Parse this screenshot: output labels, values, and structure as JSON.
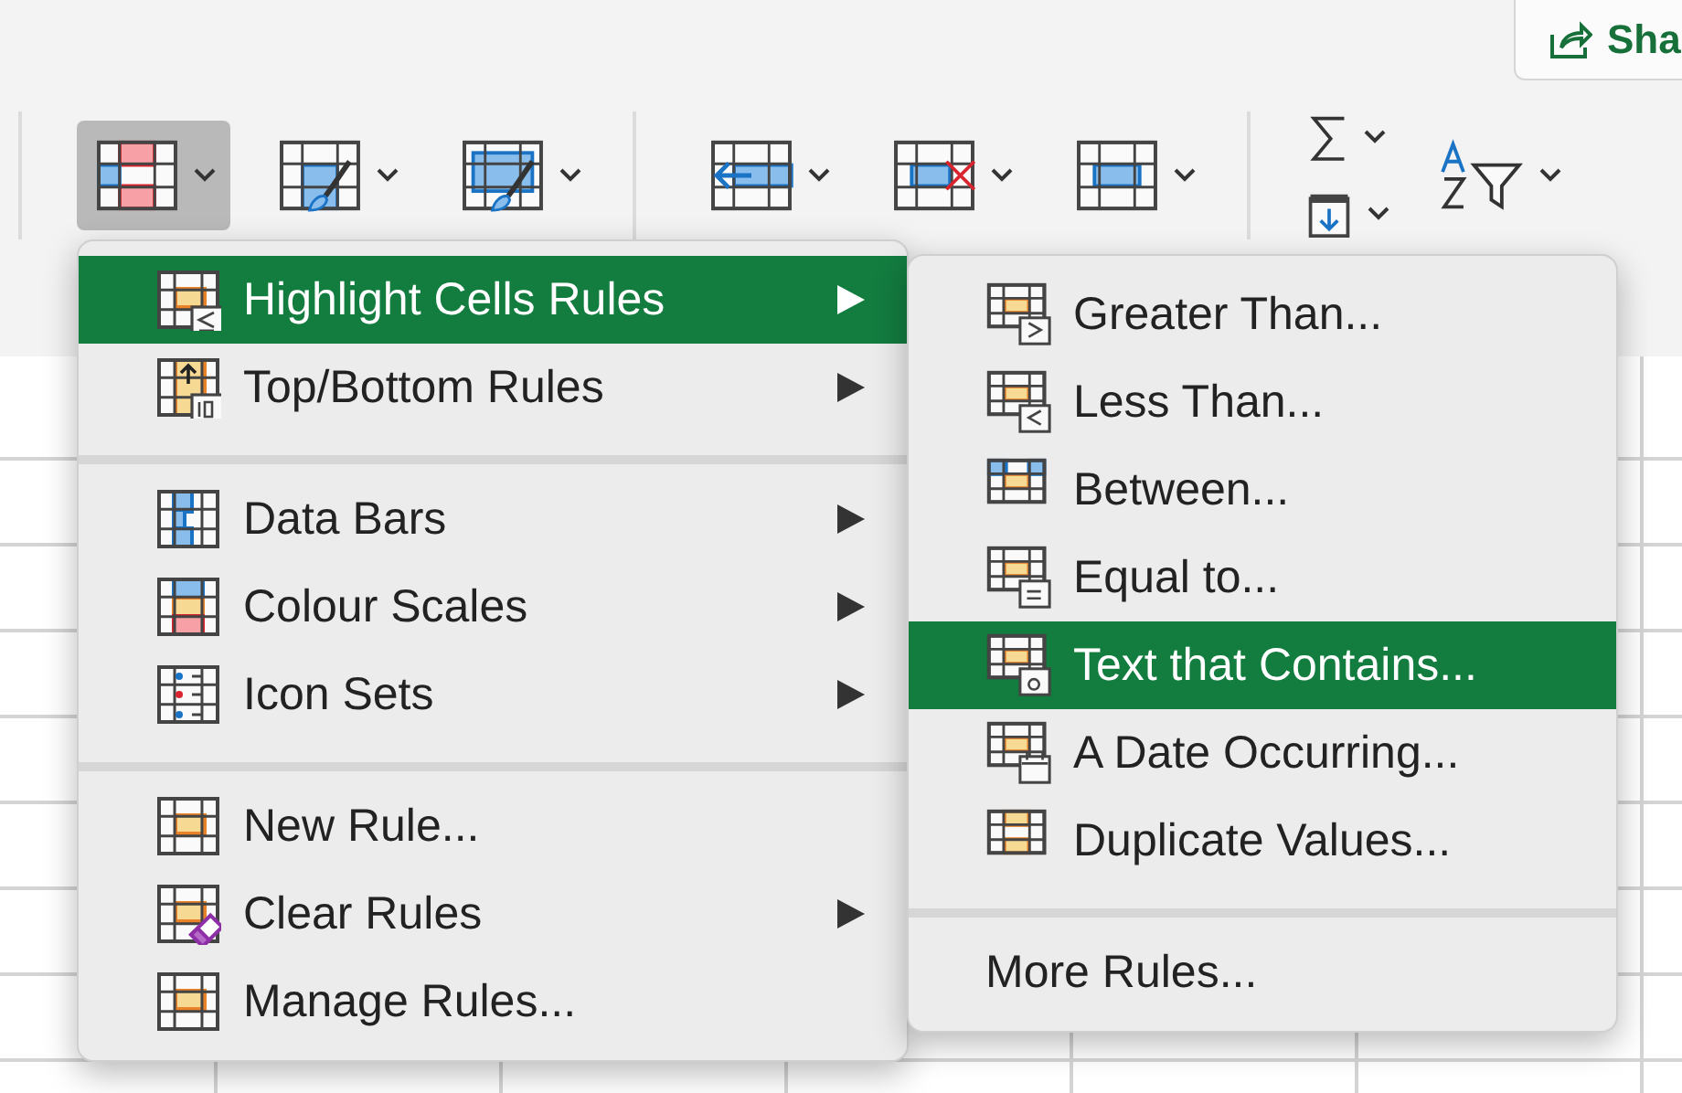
{
  "share_button": {
    "label": "Sha"
  },
  "ribbon": {
    "groups": [
      {
        "tools": [
          {
            "pressed": true
          },
          {
            "pressed": false
          },
          {
            "pressed": false
          }
        ]
      },
      {
        "tools": [
          {
            "pressed": false
          },
          {
            "pressed": false
          },
          {
            "pressed": false
          }
        ]
      },
      {
        "tools": [
          {
            "pressed": false
          },
          {
            "pressed": false
          },
          {
            "pressed": false
          }
        ]
      }
    ]
  },
  "menu": {
    "groups": [
      [
        {
          "label": "Highlight Cells Rules",
          "submenu": true,
          "selected": true
        },
        {
          "label": "Top/Bottom Rules",
          "submenu": true,
          "selected": false
        }
      ],
      [
        {
          "label": "Data Bars",
          "submenu": true,
          "selected": false
        },
        {
          "label": "Colour Scales",
          "submenu": true,
          "selected": false
        },
        {
          "label": "Icon Sets",
          "submenu": true,
          "selected": false
        }
      ],
      [
        {
          "label": "New Rule...",
          "submenu": false,
          "selected": false
        },
        {
          "label": "Clear Rules",
          "submenu": true,
          "selected": false
        },
        {
          "label": "Manage Rules...",
          "submenu": false,
          "selected": false
        }
      ]
    ]
  },
  "submenu": {
    "groups": [
      [
        {
          "label": "Greater Than...",
          "selected": false
        },
        {
          "label": "Less Than...",
          "selected": false
        },
        {
          "label": "Between...",
          "selected": false
        },
        {
          "label": "Equal to...",
          "selected": false
        },
        {
          "label": "Text that Contains...",
          "selected": true
        },
        {
          "label": "A Date Occurring...",
          "selected": false
        },
        {
          "label": "Duplicate Values...",
          "selected": false
        }
      ],
      [
        {
          "label": "More Rules..."
        }
      ]
    ]
  }
}
